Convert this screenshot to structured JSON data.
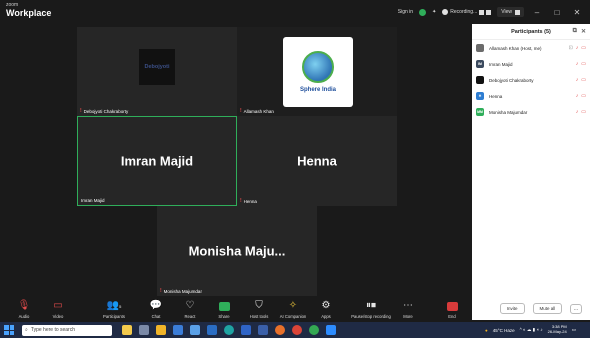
{
  "titlebar": {
    "brand_small": "zoom",
    "brand_big": "Workplace",
    "sign_in": "Sign in",
    "recording": "Recording...",
    "view": "View"
  },
  "tiles": {
    "debojyoti": {
      "name": "Debojyoti Chakraborty",
      "logo_text": "Debojyoti"
    },
    "allamash": {
      "name": "Allamash Khan",
      "logo_text": "Sphere India"
    },
    "imran": {
      "big": "Imran Majid",
      "name": "Imran Majid"
    },
    "henna": {
      "big": "Henna",
      "name": "Henna"
    },
    "monisha": {
      "big": "Monisha Maju...",
      "name": "Monisha Majumdar"
    }
  },
  "participants": {
    "title": "Participants (5)",
    "items": [
      {
        "name": "Allamash Khan (Host, me)",
        "avatar_color": "#6b6b6b",
        "initials": ""
      },
      {
        "name": "Imran Majid",
        "avatar_color": "#3b4a5e",
        "initials": "IM"
      },
      {
        "name": "Debojyoti Chakraborty",
        "avatar_color": "#111111",
        "initials": ""
      },
      {
        "name": "Henna",
        "avatar_color": "#2d7dd2",
        "initials": "H"
      },
      {
        "name": "Monisha Majumdar",
        "avatar_color": "#2fae5a",
        "initials": "MM"
      }
    ],
    "invite": "Invite",
    "mute_all": "Mute all",
    "more": "..."
  },
  "toolbar": {
    "audio": "Audio",
    "video": "Video",
    "participants": "Participants",
    "participants_count": "5",
    "chat": "Chat",
    "react": "React",
    "share": "Share",
    "host_tools": "Host tools",
    "ai_companion": "AI Companion",
    "apps": "Apps",
    "pause_stop": "Pause/stop recording",
    "more": "More",
    "end": "End"
  },
  "taskbar": {
    "search_placeholder": "Type here to search",
    "weather": "45°C Haze",
    "time": "3:38 PM",
    "date": "26-May-24"
  },
  "colors": {
    "active_speaker_border": "#2fae5a",
    "mic_off": "#e04b4b",
    "share_green": "#2fae5a",
    "end_red": "#d83b3b"
  }
}
